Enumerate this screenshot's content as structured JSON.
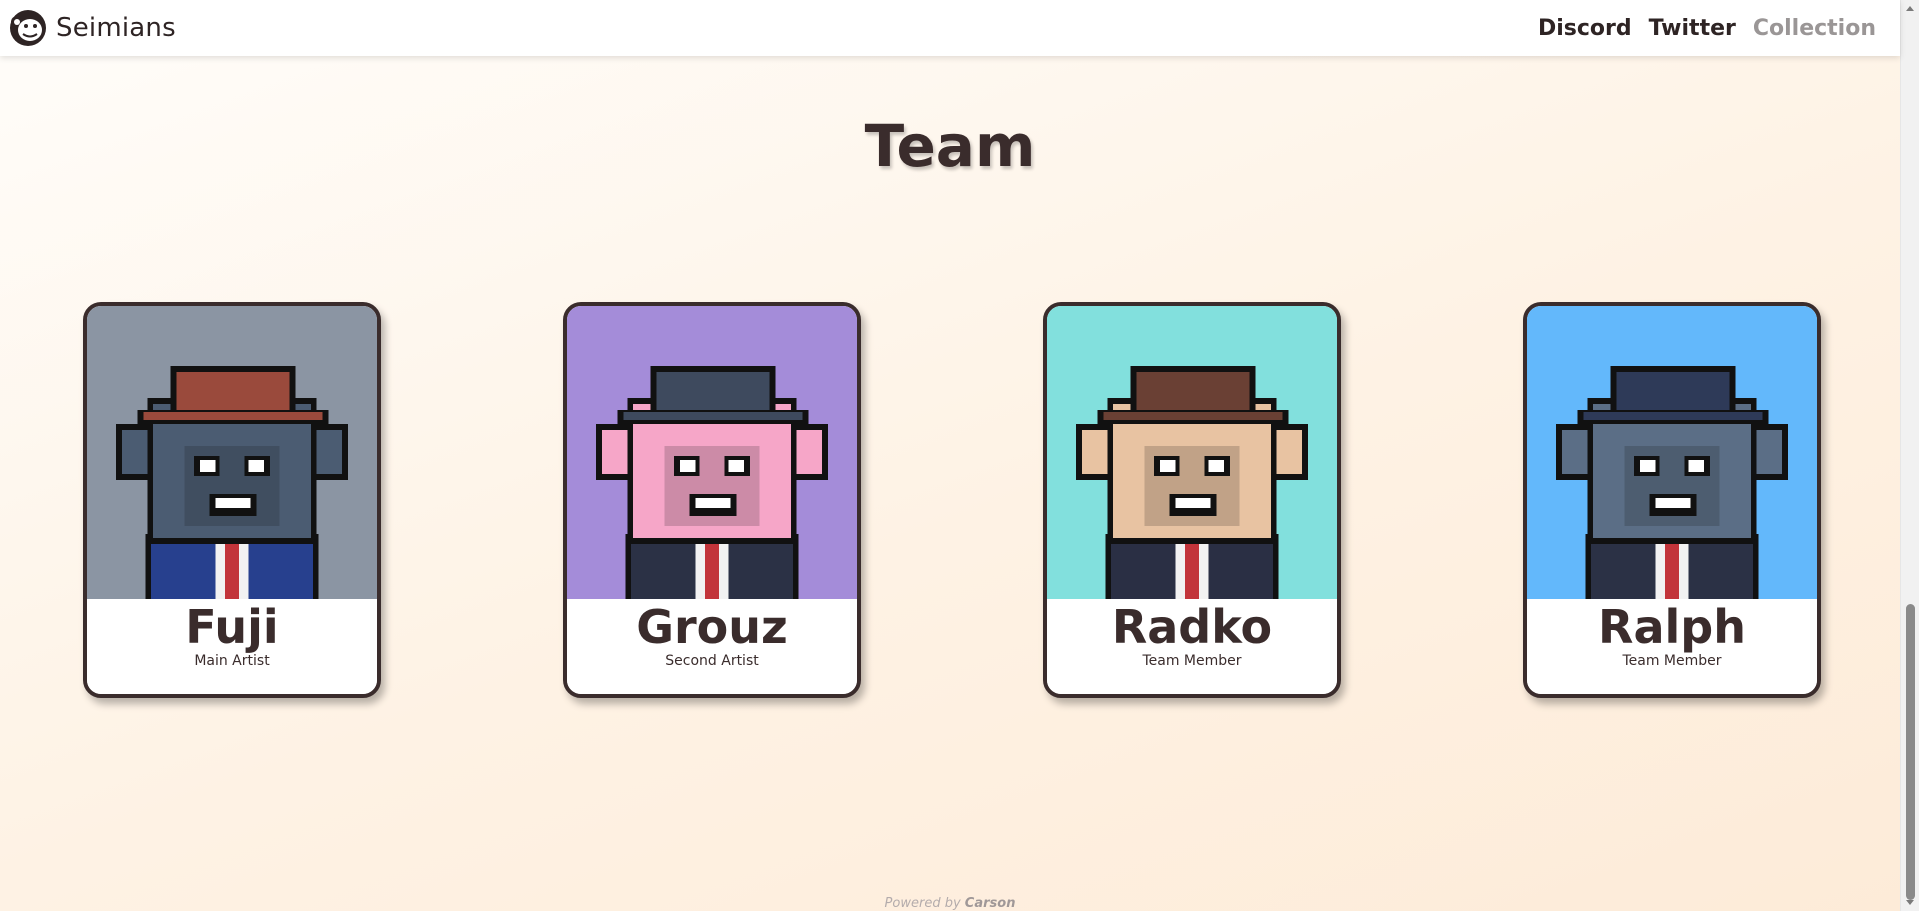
{
  "header": {
    "brand_name": "Seimians",
    "logo_icon": "monkey-logo-icon",
    "nav": [
      {
        "label": "Discord"
      },
      {
        "label": "Twitter"
      },
      {
        "label": "Collection"
      }
    ]
  },
  "section": {
    "title": "Team"
  },
  "team": [
    {
      "name": "Fuji",
      "role": "Main Artist",
      "bg": "#8b95a3",
      "fur": "#4b5c72",
      "hat": "#9a4a3c",
      "outfit": "#27408e"
    },
    {
      "name": "Grouz",
      "role": "Second Artist",
      "bg": "#a48cd9",
      "fur": "#f6a6c8",
      "hat": "#3e4a5e",
      "outfit": "#2b3145"
    },
    {
      "name": "Radko",
      "role": "Team Member",
      "bg": "#82e0dd",
      "fur": "#e8c3a2",
      "hat": "#6a4034",
      "outfit": "#2a2f44"
    },
    {
      "name": "Ralph",
      "role": "Team Member",
      "bg": "#63b8fb",
      "fur": "#5b6e86",
      "hat": "#2e3a58",
      "outfit": "#2b3145"
    }
  ],
  "footer": {
    "prefix": "Powered by",
    "brand": "Carson"
  }
}
